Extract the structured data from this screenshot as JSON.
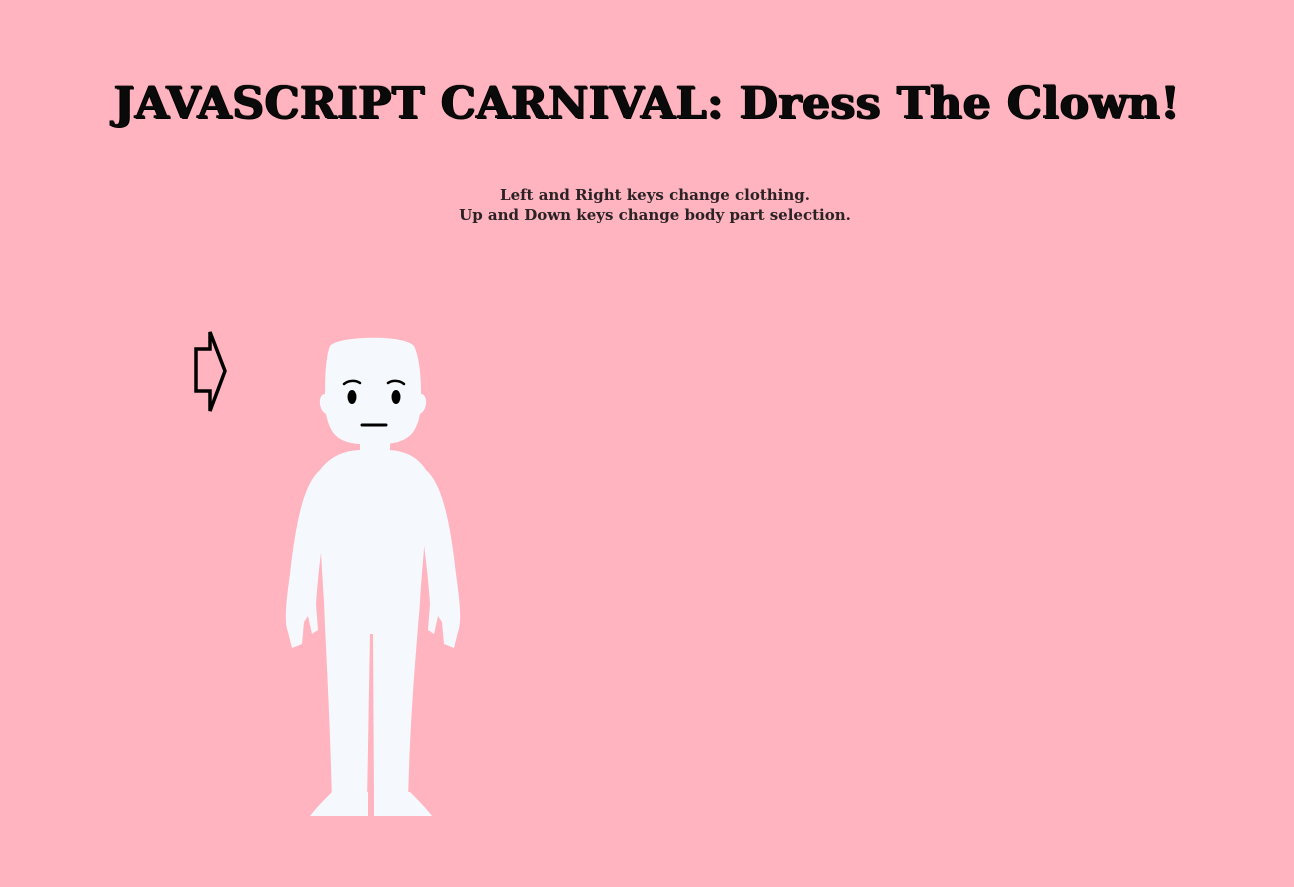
{
  "game": {
    "title": "JAVASCRIPT CARNIVAL: Dress The Clown!",
    "instructions": [
      "Left and Right keys change clothing.",
      "Up and Down keys change body part selection."
    ]
  },
  "colors": {
    "background": "#ffb4bf",
    "body": "#f5f8fc",
    "outline": "#000000"
  },
  "icons": {
    "selector": "right-arrow-outline-icon"
  }
}
